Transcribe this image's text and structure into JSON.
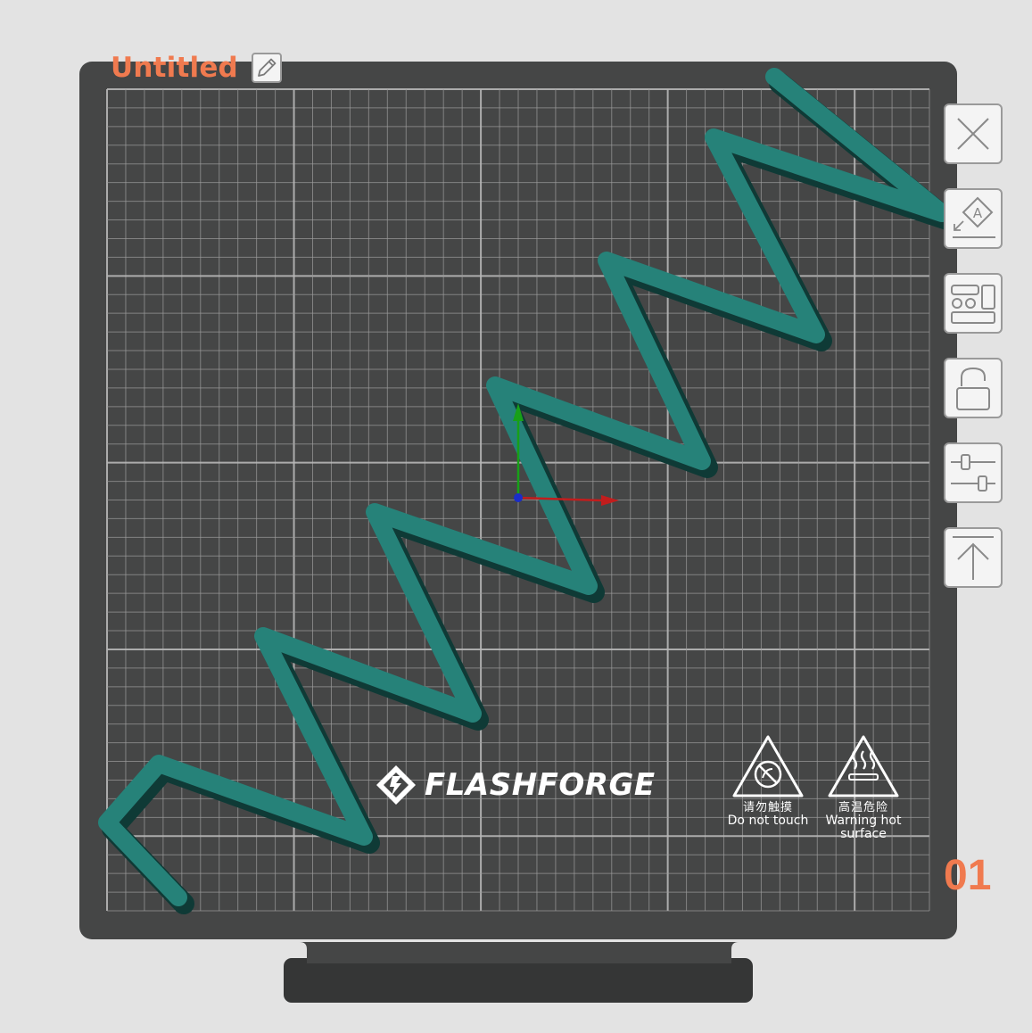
{
  "plate": {
    "title": "Untitled",
    "number": "01"
  },
  "toolbar": [
    {
      "name": "delete-plate-button",
      "icon": "close-icon"
    },
    {
      "name": "auto-orient-button",
      "icon": "auto-orient-icon"
    },
    {
      "name": "arrange-button",
      "icon": "arrange-icon"
    },
    {
      "name": "lock-plate-button",
      "icon": "unlock-icon"
    },
    {
      "name": "plate-settings-button",
      "icon": "settings-sliders-icon"
    },
    {
      "name": "send-to-print-button",
      "icon": "upload-icon"
    }
  ],
  "bed": {
    "brand": "FLASHFORGE",
    "warning_touch": {
      "cn": "请勿触摸",
      "en": "Do not touch"
    },
    "warning_hot": {
      "cn": "高温危险",
      "en": "Warning hot",
      "en2": "surface"
    }
  },
  "colors": {
    "accent": "#f07a4f",
    "bed": "#454646",
    "grid": "#9c9c9c",
    "model_top": "#268279",
    "model_side": "#0f3a36",
    "axis_x": "#c21d1d",
    "axis_y": "#18a018",
    "origin": "#1a2dc9"
  }
}
